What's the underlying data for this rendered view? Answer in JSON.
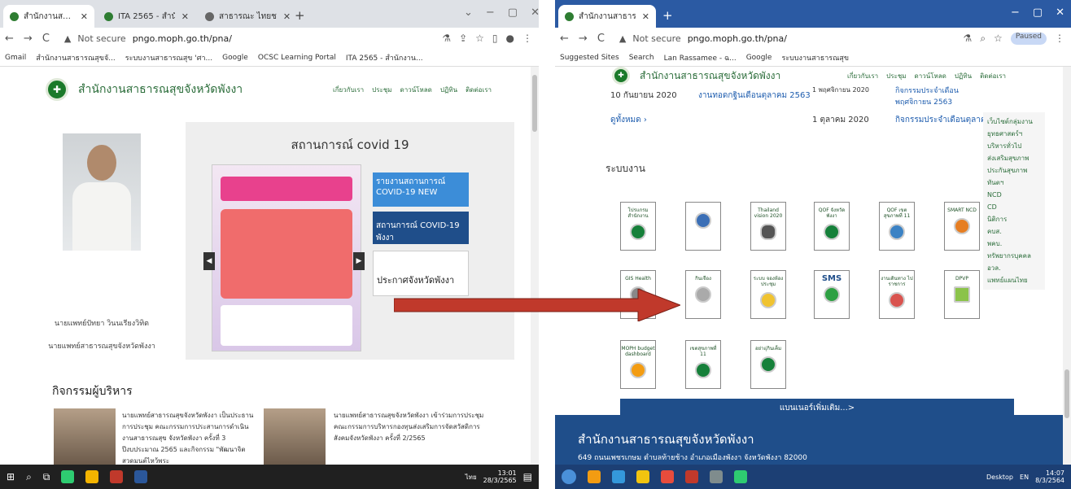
{
  "left": {
    "tabs": [
      {
        "label": "สำนักงานสาธารณสุขจังหวัดพังงา"
      },
      {
        "label": "ITA 2565 - สำนักงานสาธารณสุขจังห"
      },
      {
        "label": "สาธารณะ ไทยช"
      }
    ],
    "url": "pngo.moph.go.th/pna/",
    "not_secure": "Not secure",
    "bookmarks": [
      "Gmail",
      "สำนักงานสาธารณสุขจั...",
      "ระบบงานสาธารณสุข 'ศา...",
      "Google",
      "OCSC Learning Portal",
      "ITA 2565 - สำนักงาน..."
    ],
    "site_name": "สำนักงานสาธารณสุขจังหวัดพังงา",
    "menu": [
      "เกี่ยวกับเรา",
      "ประชุม",
      "ดาวน์โหลด",
      "ปฏิทิน",
      "ติดต่อเรา"
    ],
    "covid_title": "สถานการณ์ covid 19",
    "side_banners": [
      "รายงานสถานการณ์ COVID-19 NEW",
      "สถานการณ์ COVID-19 พังงา",
      "ประกาศจังหวัดพังงา"
    ],
    "director_name": "นายแพทย์ปัทยา วินนเรียงวิทิต",
    "director_title": "นายแพทย์สาธารณสุขจังหวัดพังงา",
    "section_title": "กิจกรรมผู้บริหาร",
    "news": [
      "นายแพทย์สาธารณสุขจังหวัดพังงา เป็นประธานการประชุม คณะกรรมการประสานการดำเนินงานสาธารณสุข จังหวัดพังงา ครั้งที่ 3 ปีงบประมาณ 2565 และกิจกรรม \"พัฒนาจิต สวดมนต์ไหว้พระ",
      "นายแพทย์สาธารณสุขจังหวัดพังงา เข้าร่วมการประชุมคณะกรรมการบริหารกองทุนส่งเสริมการจัดสวัสดิการสังคมจังหวัดพังงา ครั้งที่ 2/2565"
    ],
    "clock_time": "13:01",
    "clock_date": "28/3/2565",
    "lang": "ไทย"
  },
  "right": {
    "tabs": [
      {
        "label": "สำนักงานสาธารณสุขจังหวัดพังงา"
      }
    ],
    "url": "pngo.moph.go.th/pna/",
    "not_secure": "Not secure",
    "paused": "Paused",
    "bookmarks": [
      "Suggested Sites",
      "Search",
      "Lan Rassamee - ฉ...",
      "Google",
      "ระบบงานสาธารณสุข"
    ],
    "site_name": "สำนักงานสาธารณสุขจังหวัดพังงา",
    "menu": [
      "เกี่ยวกับเรา",
      "ประชุม",
      "ดาวน์โหลด",
      "ปฏิทิน",
      "ติดต่อเรา"
    ],
    "rows": [
      {
        "date": "10 กันยายน 2020",
        "title": "งานทอดกฐินเดือนตุลาคม 2563"
      },
      {
        "date": "1 พฤศจิกายน 2020",
        "title": "กิจกรรมประจำเดือนพฤศจิกายน 2563"
      },
      {
        "date": "1 ตุลาคม 2020",
        "title": "กิจกรรมประจำเดือนตุลาคม 25"
      }
    ],
    "see_all": "ดูทั้งหมด ›",
    "systems_title": "ระบบงาน",
    "tiles": [
      "โปรแกรม สำนักงาน",
      "",
      "Thailand vision 2020",
      "QOF จังหวัดพังงา",
      "QOF เขตสุขภาพที่ 11",
      "SMART NCD",
      "GIS Health",
      "กินเจือง",
      "ระบบ จองห้องประชุม",
      "SMS",
      "งานเดินทาง ไปราชการ",
      "DPVP",
      "MOPH budget dashboard",
      "เขตสุขภาพที่ 11",
      "อย่าแุ่กินเค็ม"
    ],
    "more_banner": "แบนเนอร์เพิ่มเติม...>",
    "sidebar": [
      "เว็บไซต์กลุ่มงาน",
      "ยุทธศาสตร์ฯ",
      "บริหารทั่วไป",
      "ส่งเสริมสุขภาพ",
      "ประกันสุขภาพ",
      "ทันตฯ",
      "NCD",
      "CD",
      "นิติการ",
      "คบส.",
      "พคบ.",
      "ทรัพยากรบุคคล",
      "อวล.",
      "แพทย์แผนไทย"
    ],
    "footer_title": "สำนักงานสาธารณสุขจังหวัดพังงา",
    "footer_address": "649 ถนนเพชรเกษม ตำบลท้ายช้าง อำเภอเมืองพังงา จังหวัดพังงา 82000",
    "desktop_label": "Desktop",
    "lang": "EN",
    "clock_time": "14:07",
    "clock_date": "8/3/2564"
  },
  "colors": {
    "accent_green": "#2b6d3a",
    "accent_blue": "#1f4e8a",
    "arrow": "#c0392b"
  }
}
